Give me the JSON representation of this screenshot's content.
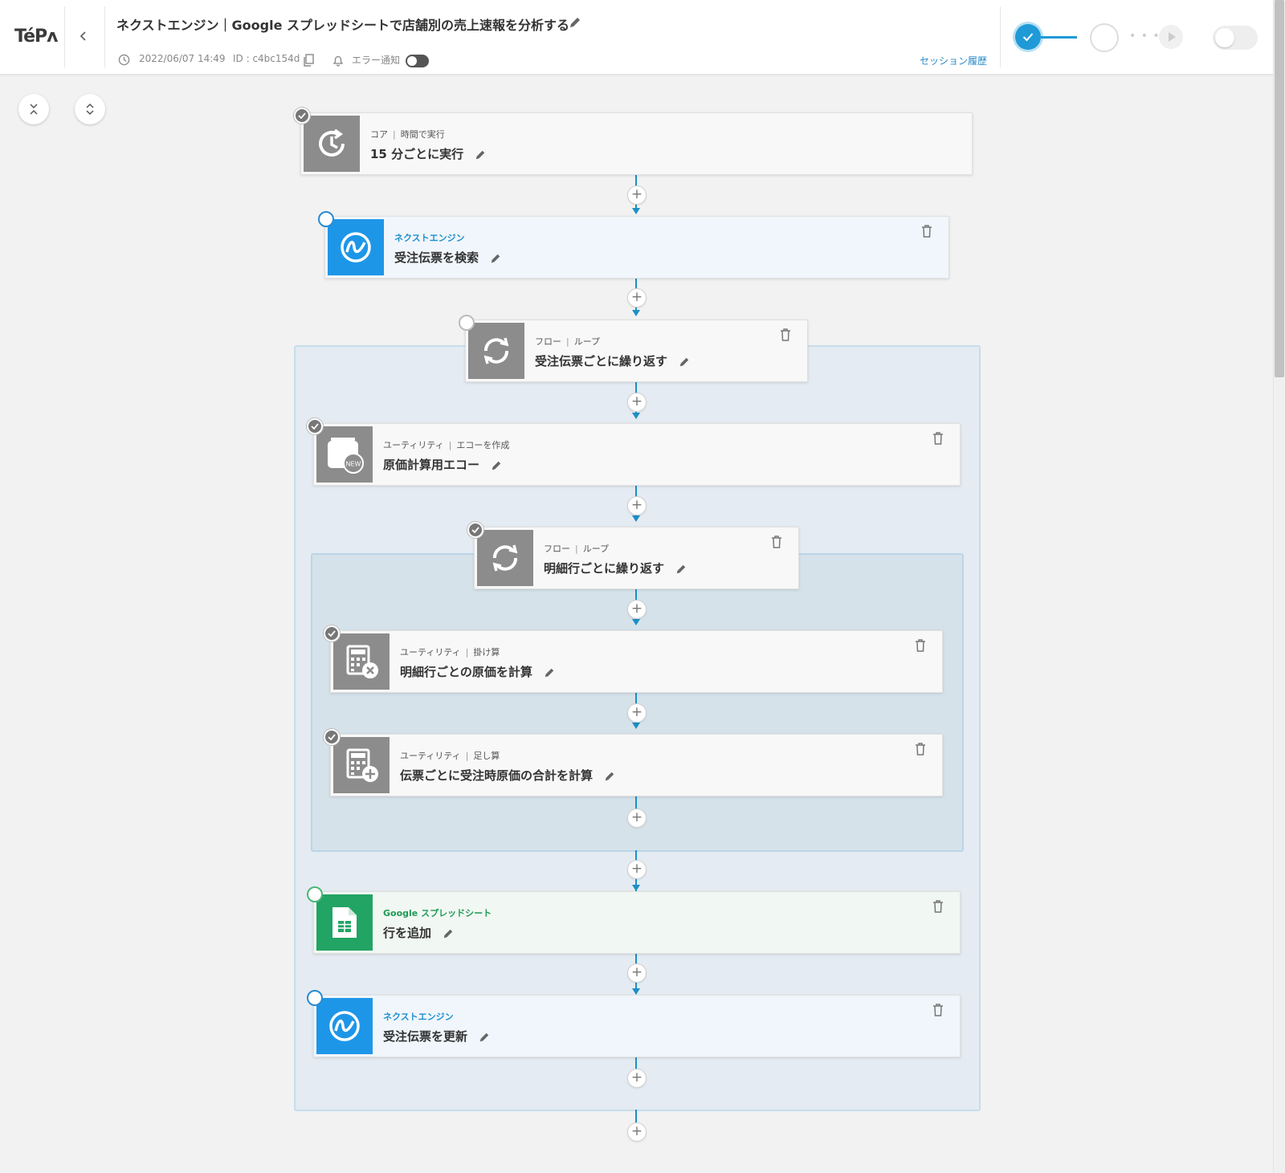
{
  "app": {
    "logo": "TéPᴧ"
  },
  "header": {
    "back_icon": "chevron-left-icon",
    "title": "ネクストエンジン｜Google スプレッドシートで店舗別の売上速報を分析する",
    "updated_at": "2022/06/07 14:49",
    "id_label": "ID : c4bc154d",
    "error_notify_label": "エラー通知",
    "error_notify_enabled": false,
    "session_history_label": "セッション履歴",
    "progress_step_done": true,
    "flow_active": false,
    "accent_color": "#1f9ad6"
  },
  "controls": {
    "collapse_all_icon": "collapse-icon",
    "expand_all_icon": "expand-icon"
  },
  "steps": [
    {
      "category": "コア",
      "action": "時間で実行",
      "name": "15 分ごとに実行",
      "icon": "clock-icon",
      "status": "done"
    },
    {
      "service": "ネクストエンジン",
      "name": "受注伝票を検索",
      "icon": "nextengine-icon",
      "status": "pending"
    },
    {
      "category": "フロー",
      "action": "ループ",
      "name": "受注伝票ごとに繰り返す",
      "icon": "loop-icon",
      "status": "pending"
    },
    {
      "category": "ユーティリティ",
      "action": "エコーを作成",
      "name": "原価計算用エコー",
      "icon": "new-echo-icon",
      "icon_text": "NEW",
      "status": "done"
    },
    {
      "category": "フロー",
      "action": "ループ",
      "name": "明細行ごとに繰り返す",
      "icon": "loop-icon",
      "status": "done"
    },
    {
      "category": "ユーティリティ",
      "action": "掛け算",
      "name": "明細行ごとの原価を計算",
      "icon": "calculator-multiply-icon",
      "status": "done"
    },
    {
      "category": "ユーティリティ",
      "action": "足し算",
      "name": "伝票ごとに受注時原価の合計を計算",
      "icon": "calculator-add-icon",
      "status": "done"
    },
    {
      "service": "Google スプレッドシート",
      "name": "行を追加",
      "icon": "google-sheets-icon",
      "status": "pending"
    },
    {
      "service": "ネクストエンジン",
      "name": "受注伝票を更新",
      "icon": "nextengine-icon",
      "status": "pending"
    }
  ],
  "colors": {
    "nextengine": "#1e96e8",
    "google_sheets": "#21a464",
    "core_gray": "#8c8c8c",
    "connector": "#1d8fc4"
  }
}
